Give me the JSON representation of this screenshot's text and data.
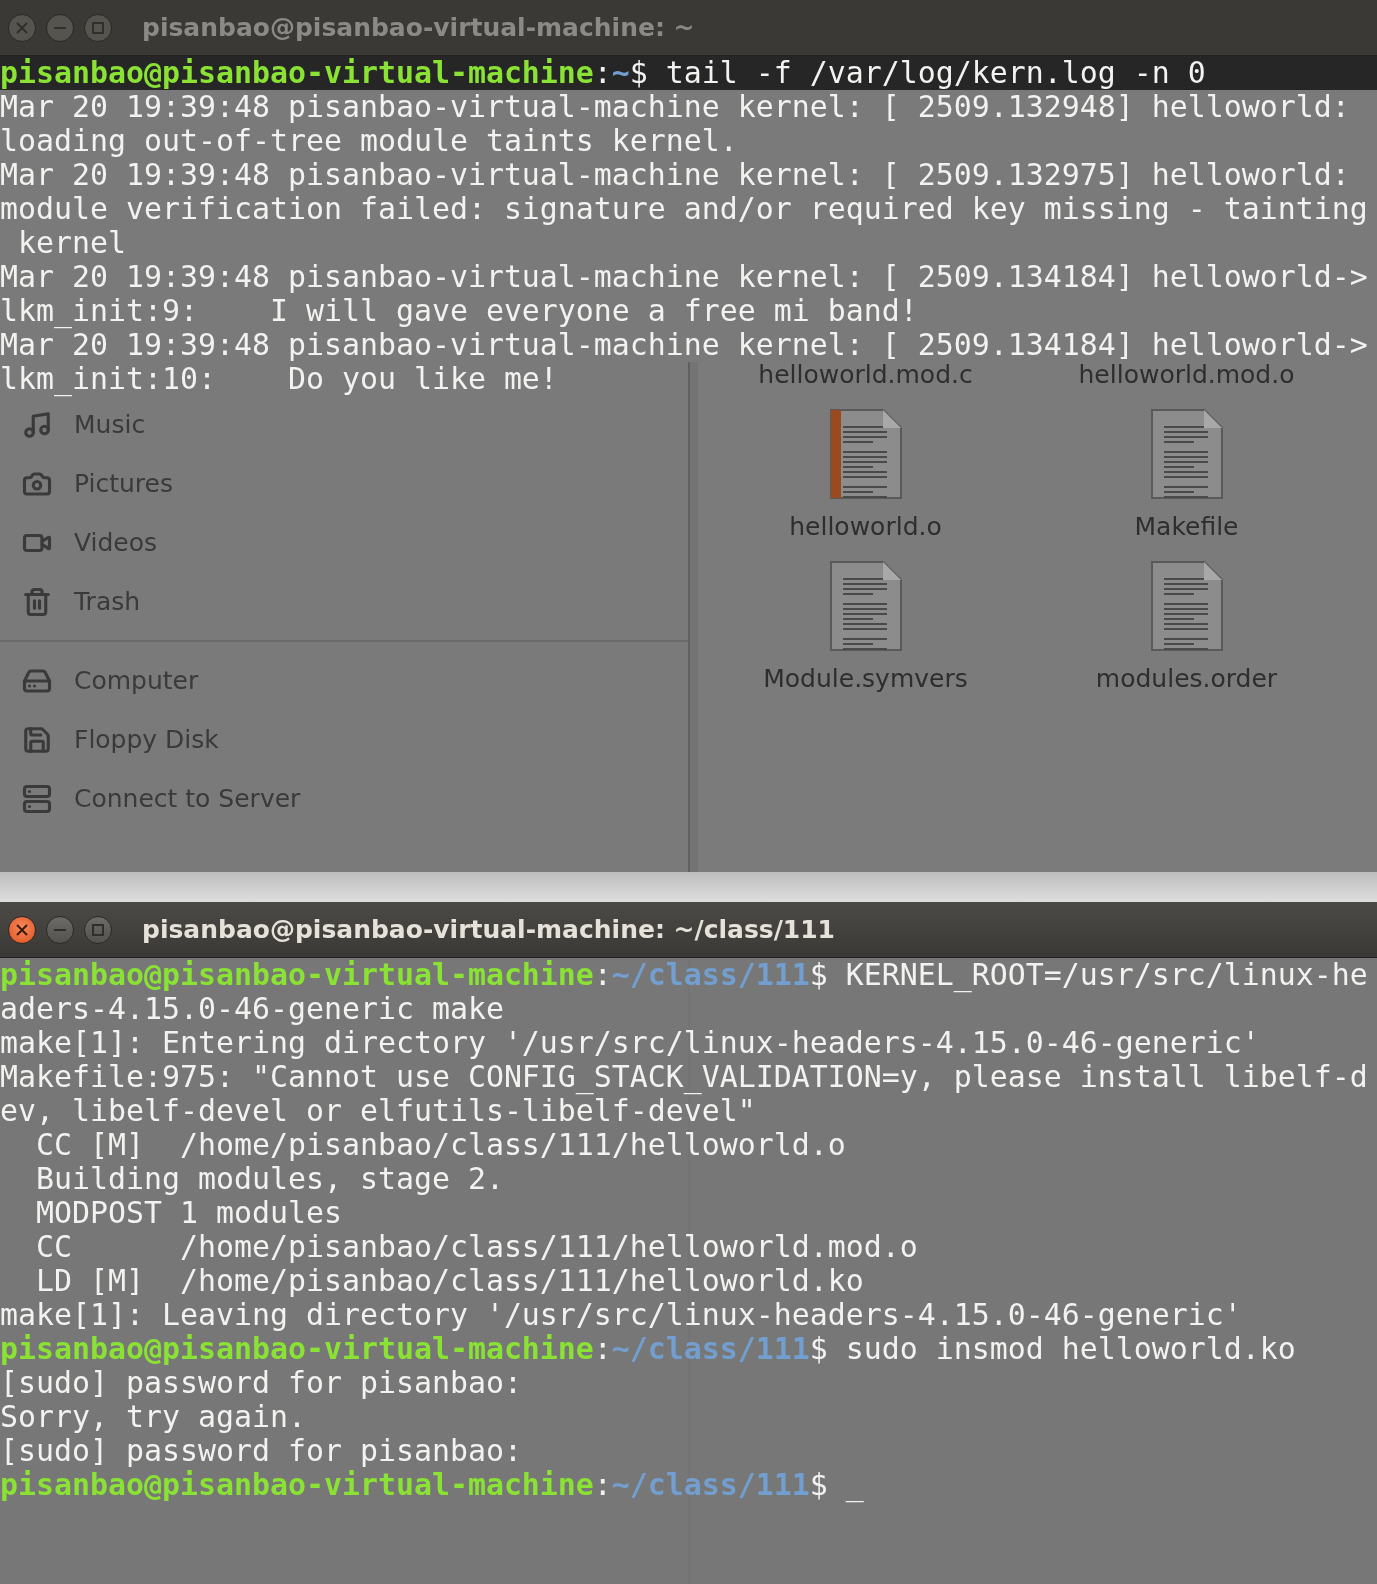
{
  "top_terminal": {
    "title": "pisanbao@pisanbao-virtual-machine: ~",
    "active": false,
    "lines": [
      {
        "kind": "prompt",
        "user": "pisanbao@pisanbao-virtual-machine",
        "sep": ":",
        "path": "~",
        "command": "$ tail -f /var/log/kern.log -n 0"
      },
      {
        "kind": "output",
        "text": "Mar 20 19:39:48 pisanbao-virtual-machine kernel: [ 2509.132948] helloworld:"
      },
      {
        "kind": "output",
        "text": "loading out-of-tree module taints kernel."
      },
      {
        "kind": "output",
        "text": "Mar 20 19:39:48 pisanbao-virtual-machine kernel: [ 2509.132975] helloworld:"
      },
      {
        "kind": "output",
        "text": "module verification failed: signature and/or required key missing - tainting"
      },
      {
        "kind": "output",
        "text": " kernel"
      },
      {
        "kind": "output",
        "text": "Mar 20 19:39:48 pisanbao-virtual-machine kernel: [ 2509.134184] helloworld->"
      },
      {
        "kind": "output",
        "text": "lkm_init:9:    I will gave everyone a free mi band!"
      },
      {
        "kind": "output",
        "text": "Mar 20 19:39:48 pisanbao-virtual-machine kernel: [ 2509.134184] helloworld->"
      },
      {
        "kind": "output",
        "text": "lkm_init:10:    Do you like me!"
      }
    ]
  },
  "file_manager": {
    "sidebar": {
      "places": [
        "Music",
        "Pictures",
        "Videos",
        "Trash"
      ],
      "devices": [
        "Computer",
        "Floppy Disk",
        "Connect to Server"
      ]
    },
    "files": [
      {
        "name": "helloworld.mod.c",
        "selected": false
      },
      {
        "name": "helloworld.mod.o",
        "selected": false
      },
      {
        "name": "helloworld.o",
        "kind": "object",
        "selected": false
      },
      {
        "name": "Makefile",
        "kind": "text",
        "selected": false
      },
      {
        "name": "Module.symvers",
        "kind": "text",
        "selected": false
      },
      {
        "name": "modules.order",
        "kind": "text",
        "selected": false
      }
    ]
  },
  "bottom_terminal": {
    "title": "pisanbao@pisanbao-virtual-machine: ~/class/111",
    "active": true,
    "lines": [
      {
        "kind": "prompt",
        "user": "pisanbao@pisanbao-virtual-machine",
        "sep": ":",
        "path": "~/class/111",
        "command": "$ KERNEL_ROOT=/usr/src/linux-he"
      },
      {
        "kind": "output",
        "text": "aders-4.15.0-46-generic make"
      },
      {
        "kind": "output",
        "text": "make[1]: Entering directory '/usr/src/linux-headers-4.15.0-46-generic'"
      },
      {
        "kind": "output",
        "text": "Makefile:975: \"Cannot use CONFIG_STACK_VALIDATION=y, please install libelf-d"
      },
      {
        "kind": "output",
        "text": "ev, libelf-devel or elfutils-libelf-devel\""
      },
      {
        "kind": "output",
        "text": "  CC [M]  /home/pisanbao/class/111/helloworld.o"
      },
      {
        "kind": "output",
        "text": "  Building modules, stage 2."
      },
      {
        "kind": "output",
        "text": "  MODPOST 1 modules"
      },
      {
        "kind": "output",
        "text": "  CC      /home/pisanbao/class/111/helloworld.mod.o"
      },
      {
        "kind": "output",
        "text": "  LD [M]  /home/pisanbao/class/111/helloworld.ko"
      },
      {
        "kind": "output",
        "text": "make[1]: Leaving directory '/usr/src/linux-headers-4.15.0-46-generic'"
      },
      {
        "kind": "prompt",
        "user": "pisanbao@pisanbao-virtual-machine",
        "sep": ":",
        "path": "~/class/111",
        "command": "$ sudo insmod helloworld.ko"
      },
      {
        "kind": "output",
        "text": "[sudo] password for pisanbao:"
      },
      {
        "kind": "output",
        "text": "Sorry, try again."
      },
      {
        "kind": "output",
        "text": "[sudo] password for pisanbao:"
      },
      {
        "kind": "prompt",
        "user": "pisanbao@pisanbao-virtual-machine",
        "sep": ":",
        "path": "~/class/111",
        "command": "$ _"
      }
    ]
  }
}
